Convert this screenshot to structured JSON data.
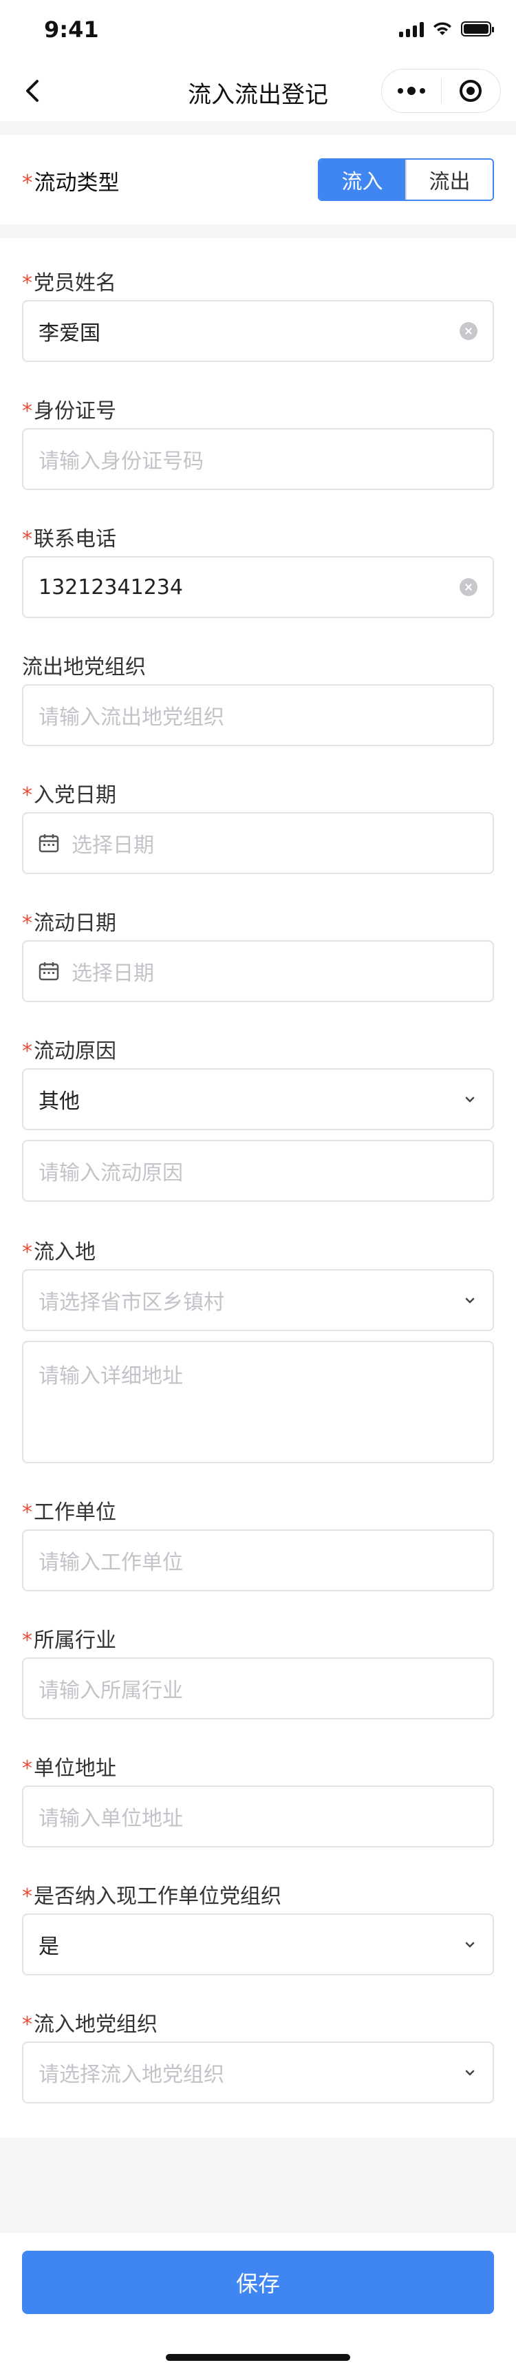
{
  "status": {
    "time": "9:41"
  },
  "navbar": {
    "title": "流入流出登记"
  },
  "flow_type": {
    "label": "流动类型",
    "required": "*",
    "options": [
      "流入",
      "流出"
    ],
    "selected": "流入"
  },
  "fields": {
    "name": {
      "label": "党员姓名",
      "value": "李爱国"
    },
    "id_number": {
      "label": "身份证号",
      "placeholder": "请输入身份证号码"
    },
    "phone": {
      "label": "联系电话",
      "value": "13212341234"
    },
    "out_org": {
      "label": "流出地党组织",
      "placeholder": "请输入流出地党组织"
    },
    "join_date": {
      "label": "入党日期",
      "placeholder": "选择日期"
    },
    "flow_date": {
      "label": "流动日期",
      "placeholder": "选择日期"
    },
    "flow_reason": {
      "label": "流动原因",
      "value": "其他",
      "detail_placeholder": "请输入流动原因"
    },
    "destination": {
      "label": "流入地",
      "region_placeholder": "请选择省市区乡镇村",
      "address_placeholder": "请输入详细地址"
    },
    "employer": {
      "label": "工作单位",
      "placeholder": "请输入工作单位"
    },
    "industry": {
      "label": "所属行业",
      "placeholder": "请输入所属行业"
    },
    "employer_address": {
      "label": "单位地址",
      "placeholder": "请输入单位地址"
    },
    "in_employer_org": {
      "label": "是否纳入现工作单位党组织",
      "value": "是"
    },
    "in_org": {
      "label": "流入地党组织",
      "placeholder": "请选择流入地党组织"
    }
  },
  "required_mark": "*",
  "actions": {
    "save": "保存"
  },
  "colors": {
    "primary": "#3f86f2",
    "required": "#e84d3c",
    "placeholder": "#c2c4c9"
  }
}
